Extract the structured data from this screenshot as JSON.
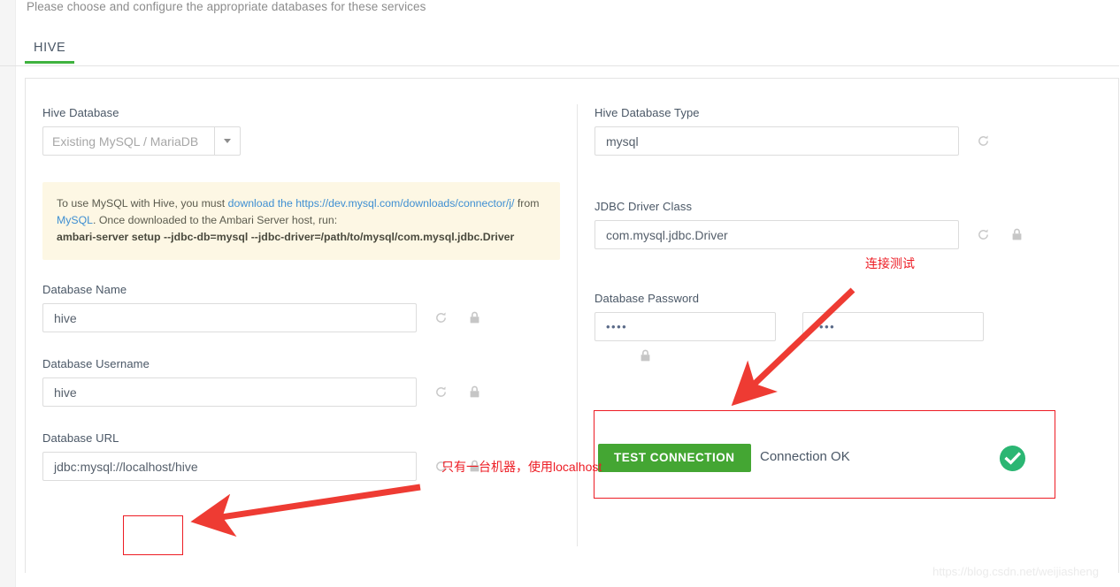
{
  "page": {
    "hint": "Please choose and configure the appropriate databases for these services",
    "watermark": "https://blog.csdn.net/weijiasheng"
  },
  "tabs": [
    {
      "label": "HIVE",
      "active": true
    }
  ],
  "colors": {
    "accent_green": "#3fb23f",
    "button_green": "#44a633",
    "status_ok_green": "#2bb673",
    "annotation_red": "#ed1c24",
    "link_blue": "#3f8fd2",
    "alert_bg": "#fdf7e4"
  },
  "left_column": {
    "hive_database": {
      "label": "Hive Database",
      "selected": "Existing MySQL / MariaDB",
      "icon": "chevron-down-icon"
    },
    "alert": {
      "line1_pre": "To use MySQL with Hive, you must ",
      "link1": "download the https://dev.mysql.com/downloads/connector/j/",
      "line1_mid": " from ",
      "link2": "MySQL",
      "line1_post": ". Once downloaded to the Ambari Server host, run:",
      "command": "ambari-server setup --jdbc-db=mysql --jdbc-driver=/path/to/mysql/com.mysql.jdbc.Driver"
    },
    "database_name": {
      "label": "Database Name",
      "value": "hive",
      "refresh_icon": "refresh-icon",
      "lock_icon": "lock-icon"
    },
    "database_username": {
      "label": "Database Username",
      "value": "hive",
      "refresh_icon": "refresh-icon",
      "lock_icon": "lock-icon"
    },
    "database_url": {
      "label": "Database URL",
      "value": "jdbc:mysql://localhost/hive",
      "refresh_icon": "refresh-icon",
      "lock_icon": "lock-icon"
    }
  },
  "right_column": {
    "hive_database_type": {
      "label": "Hive Database Type",
      "value": "mysql",
      "refresh_icon": "refresh-icon"
    },
    "jdbc_driver_class": {
      "label": "JDBC Driver Class",
      "value": "com.mysql.jdbc.Driver",
      "refresh_icon": "refresh-icon",
      "lock_icon": "lock-icon"
    },
    "database_password": {
      "label": "Database Password",
      "value": "••••",
      "confirm_value": "••••",
      "lock_icon": "lock-icon"
    },
    "test_connection": {
      "button_label": "TEST CONNECTION",
      "status_text": "Connection OK",
      "status_icon": "check-circle-icon"
    }
  },
  "annotations": {
    "cn_test_connection": "连接测试",
    "cn_localhost": "只有一台机器，使用localhost"
  }
}
